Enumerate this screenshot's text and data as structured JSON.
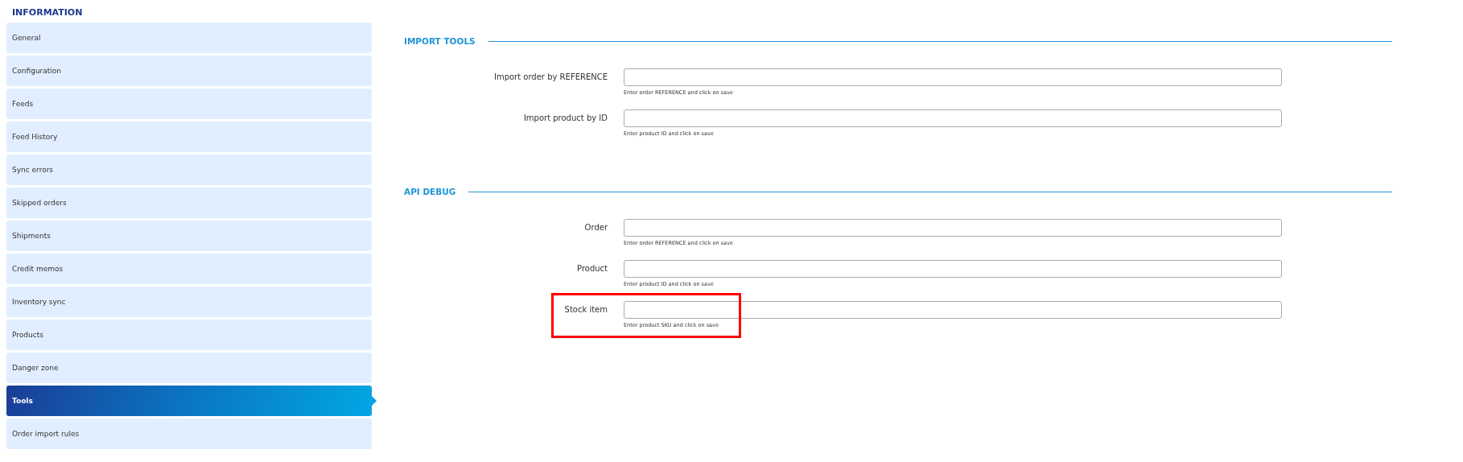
{
  "heading": "INFORMATION",
  "sidebar": {
    "items": [
      {
        "label": "General",
        "selected": false
      },
      {
        "label": "Configuration",
        "selected": false
      },
      {
        "label": "Feeds",
        "selected": false
      },
      {
        "label": "Feed History",
        "selected": false
      },
      {
        "label": "Sync errors",
        "selected": false
      },
      {
        "label": "Skipped orders",
        "selected": false
      },
      {
        "label": "Shipments",
        "selected": false
      },
      {
        "label": "Credit memos",
        "selected": false
      },
      {
        "label": "Inventory sync",
        "selected": false
      },
      {
        "label": "Products",
        "selected": false
      },
      {
        "label": "Danger zone",
        "selected": false
      },
      {
        "label": "Tools",
        "selected": true
      },
      {
        "label": "Order import rules",
        "selected": false
      }
    ]
  },
  "sections": [
    {
      "title": "IMPORT TOOLS",
      "fields": [
        {
          "label": "Import order by REFERENCE",
          "help": "Enter order REFERENCE and click on save",
          "highlighted": false
        },
        {
          "label": "Import product by ID",
          "help": "Enter product ID and click on save",
          "highlighted": false
        }
      ]
    },
    {
      "title": "API DEBUG",
      "fields": [
        {
          "label": "Order",
          "help": "Enter order REFERENCE and click on save",
          "highlighted": false
        },
        {
          "label": "Product",
          "help": "Enter product ID and click on save",
          "highlighted": false
        },
        {
          "label": "Stock item",
          "help": "Enter product SKU and click on save",
          "highlighted": true
        }
      ]
    }
  ]
}
